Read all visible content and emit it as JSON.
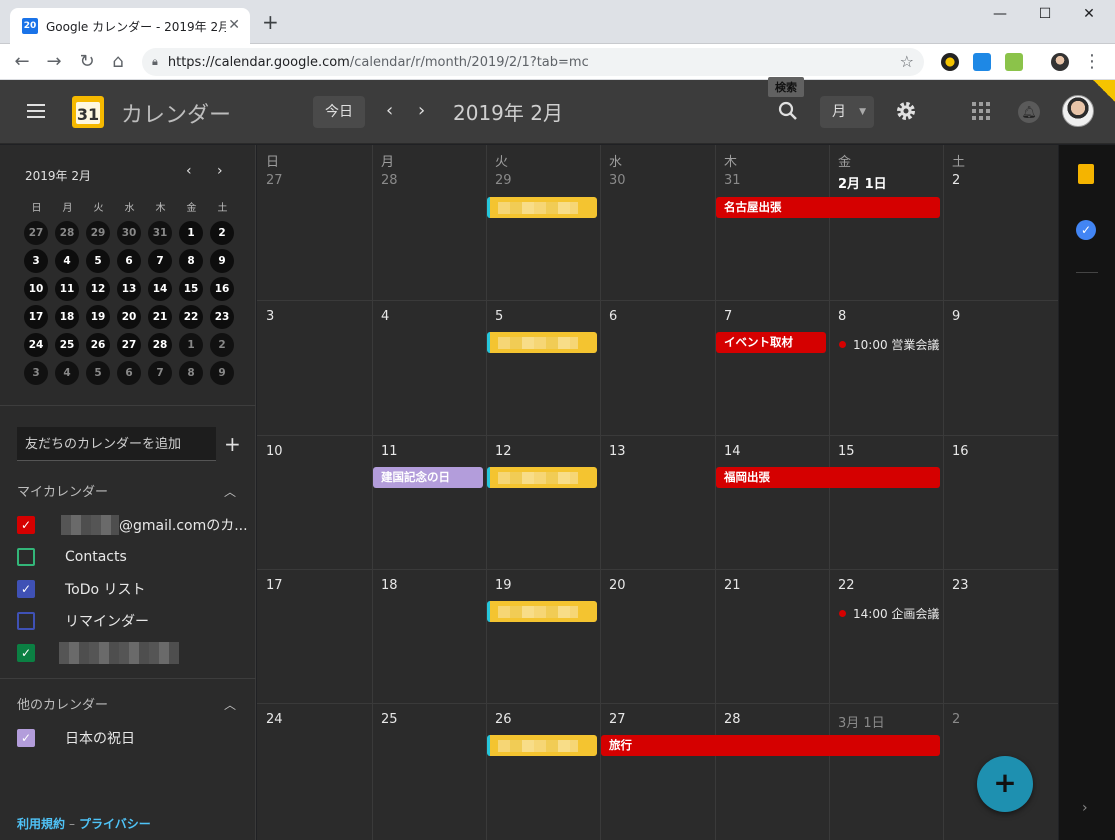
{
  "browser": {
    "tab_title": "Google カレンダー - 2019年 2月",
    "favicon_text": "20",
    "tab_close": "✕",
    "new_tab": "+",
    "url_host": "https://calendar.google.com",
    "url_path": "/calendar/r/month/2019/2/1?tab=mc",
    "window_controls": {
      "minimize": "—",
      "maximize": "☐",
      "close": "✕"
    }
  },
  "header": {
    "title": "カレンダー",
    "logo_day": "31",
    "today_label": "今日",
    "month_title": "2019年 2月",
    "search_tooltip": "検索",
    "view_label": "月",
    "prev": "‹",
    "next": "›"
  },
  "sidebar": {
    "mini_title": "2019年 2月",
    "mini_dows": [
      "日",
      "月",
      "火",
      "水",
      "木",
      "金",
      "土"
    ],
    "mini_days": [
      [
        "27",
        "28",
        "29",
        "30",
        "31",
        "1",
        "2"
      ],
      [
        "3",
        "4",
        "5",
        "6",
        "7",
        "8",
        "9"
      ],
      [
        "10",
        "11",
        "12",
        "13",
        "14",
        "15",
        "16"
      ],
      [
        "17",
        "18",
        "19",
        "20",
        "21",
        "22",
        "23"
      ],
      [
        "24",
        "25",
        "26",
        "27",
        "28",
        "1",
        "2"
      ],
      [
        "3",
        "4",
        "5",
        "6",
        "7",
        "8",
        "9"
      ]
    ],
    "friend_placeholder": "友だちのカレンダーを追加",
    "add_symbol": "+",
    "my_calendars_title": "マイカレンダー",
    "my_calendars": [
      {
        "label": "@gmail.comのカ...",
        "color": "#d50000",
        "checked": true
      },
      {
        "label": "Contacts",
        "color": "#33b679",
        "checked": false
      },
      {
        "label": "ToDo リスト",
        "color": "#3f51b5",
        "checked": true
      },
      {
        "label": "リマインダー",
        "color": "#3f51b5",
        "checked": false
      },
      {
        "label": "",
        "color": "#0b8043",
        "checked": true
      }
    ],
    "other_calendars_title": "他のカレンダー",
    "other_calendars": [
      {
        "label": "日本の祝日",
        "color": "#b39ddb",
        "checked": true
      }
    ],
    "footer_terms": "利用規約",
    "footer_sep": "–",
    "footer_privacy": "プライバシー"
  },
  "grid": {
    "dows": [
      "日",
      "月",
      "火",
      "水",
      "木",
      "金",
      "土"
    ],
    "weeks": [
      [
        "27",
        "28",
        "29",
        "30",
        "31",
        "2月 1日",
        "2"
      ],
      [
        "3",
        "4",
        "5",
        "6",
        "7",
        "8",
        "9"
      ],
      [
        "10",
        "11",
        "12",
        "13",
        "14",
        "15",
        "16"
      ],
      [
        "17",
        "18",
        "19",
        "20",
        "21",
        "22",
        "23"
      ],
      [
        "24",
        "25",
        "26",
        "27",
        "28",
        "3月 1日",
        "2"
      ]
    ],
    "events": [
      {
        "week": 0,
        "col": 2,
        "span": 1,
        "style": "yellow",
        "label": ""
      },
      {
        "week": 0,
        "col": 4,
        "span": 2,
        "style": "red",
        "label": "名古屋出張"
      },
      {
        "week": 1,
        "col": 2,
        "span": 1,
        "style": "yellow",
        "label": ""
      },
      {
        "week": 1,
        "col": 4,
        "span": 1,
        "style": "red",
        "label": "イベント取材"
      },
      {
        "week": 2,
        "col": 1,
        "span": 1,
        "style": "lilac",
        "label": "建国記念の日"
      },
      {
        "week": 2,
        "col": 2,
        "span": 1,
        "style": "yellow",
        "label": ""
      },
      {
        "week": 2,
        "col": 4,
        "span": 2,
        "style": "red",
        "label": "福岡出張"
      },
      {
        "week": 3,
        "col": 2,
        "span": 1,
        "style": "yellow",
        "label": ""
      },
      {
        "week": 4,
        "col": 2,
        "span": 1,
        "style": "yellow",
        "label": ""
      },
      {
        "week": 4,
        "col": 3,
        "span": 3,
        "style": "red",
        "label": "旅行"
      }
    ],
    "timed_events": [
      {
        "week": 1,
        "col": 5,
        "label": "10:00 営業会議"
      },
      {
        "week": 3,
        "col": 5,
        "label": "14:00 企画会議"
      }
    ]
  },
  "fab_label": "+",
  "colors": {
    "accent_red": "#d50000",
    "event_yellow": "#f4c430",
    "holiday_lilac": "#b39ddb",
    "fab": "#1e90b0"
  }
}
